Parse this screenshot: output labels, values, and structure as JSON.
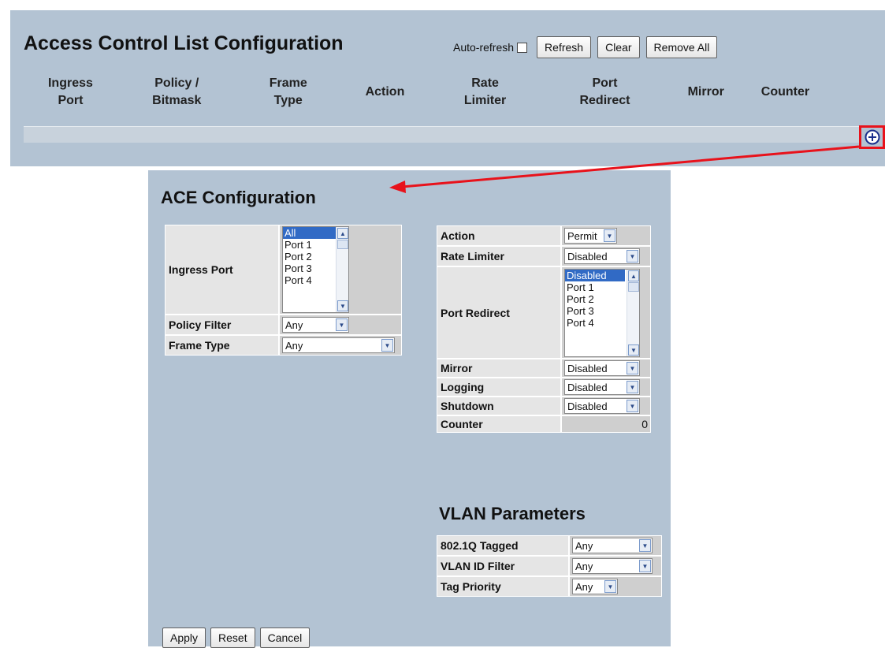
{
  "acl": {
    "title": "Access Control List Configuration",
    "auto_refresh_label": "Auto-refresh",
    "auto_refresh_checked": false,
    "buttons": {
      "refresh": "Refresh",
      "clear": "Clear",
      "remove_all": "Remove All"
    },
    "columns": [
      {
        "line1": "Ingress",
        "line2": "Port"
      },
      {
        "line1": "Policy /",
        "line2": "Bitmask"
      },
      {
        "line1": "Frame",
        "line2": "Type"
      },
      {
        "line1": "Action",
        "line2": ""
      },
      {
        "line1": "Rate",
        "line2": "Limiter"
      },
      {
        "line1": "Port",
        "line2": "Redirect"
      },
      {
        "line1": "Mirror",
        "line2": ""
      },
      {
        "line1": "Counter",
        "line2": ""
      }
    ],
    "add_icon": "plus-circle-icon",
    "highlight_color": "#e8121b"
  },
  "ace": {
    "title": "ACE Configuration",
    "ingress_port": {
      "label": "Ingress Port",
      "options": [
        "All",
        "Port 1",
        "Port 2",
        "Port 3",
        "Port 4"
      ],
      "selected": "All"
    },
    "policy_filter": {
      "label": "Policy Filter",
      "value": "Any"
    },
    "frame_type": {
      "label": "Frame Type",
      "value": "Any"
    },
    "action": {
      "label": "Action",
      "value": "Permit"
    },
    "rate_limiter": {
      "label": "Rate Limiter",
      "value": "Disabled"
    },
    "port_redirect": {
      "label": "Port Redirect",
      "options": [
        "Disabled",
        "Port 1",
        "Port 2",
        "Port 3",
        "Port 4"
      ],
      "selected": "Disabled"
    },
    "mirror": {
      "label": "Mirror",
      "value": "Disabled"
    },
    "logging": {
      "label": "Logging",
      "value": "Disabled"
    },
    "shutdown": {
      "label": "Shutdown",
      "value": "Disabled"
    },
    "counter": {
      "label": "Counter",
      "value": "0"
    },
    "vlan": {
      "title": "VLAN Parameters",
      "tagged": {
        "label": "802.1Q Tagged",
        "value": "Any"
      },
      "vlan_id_filter": {
        "label": "VLAN ID Filter",
        "value": "Any"
      },
      "tag_priority": {
        "label": "Tag Priority",
        "value": "Any"
      }
    },
    "buttons": {
      "apply": "Apply",
      "reset": "Reset",
      "cancel": "Cancel"
    }
  }
}
